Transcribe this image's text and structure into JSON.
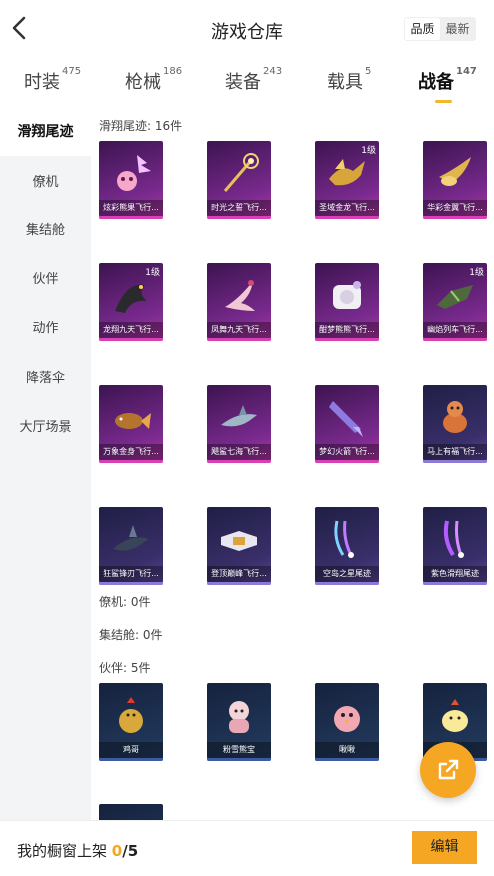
{
  "header": {
    "title": "游戏仓库",
    "sort_quality": "品质",
    "sort_newest": "最新"
  },
  "tabs": [
    {
      "label": "时装",
      "count": "475"
    },
    {
      "label": "枪械",
      "count": "186"
    },
    {
      "label": "装备",
      "count": "243"
    },
    {
      "label": "载具",
      "count": "5"
    },
    {
      "label": "战备",
      "count": "147"
    }
  ],
  "sidebar": {
    "items": [
      {
        "label": "滑翔尾迹"
      },
      {
        "label": "僚机"
      },
      {
        "label": "集结舱"
      },
      {
        "label": "伙伴"
      },
      {
        "label": "动作"
      },
      {
        "label": "降落伞"
      },
      {
        "label": "大厅场景"
      }
    ]
  },
  "sections": {
    "glide": {
      "title": "滑翔尾迹: 16件",
      "items": [
        {
          "name": "炫彩熊果飞行...",
          "level": "",
          "icon": "bear-wing-icon"
        },
        {
          "name": "时光之誓飞行...",
          "level": "",
          "icon": "golden-scepter-icon"
        },
        {
          "name": "圣域金龙飞行...",
          "level": "1级",
          "icon": "golden-dragon-icon"
        },
        {
          "name": "华彩金翼飞行...",
          "level": "",
          "icon": "golden-wing-icon"
        },
        {
          "name": "龙翔九天飞行...",
          "level": "1级",
          "icon": "black-dragon-icon"
        },
        {
          "name": "凤舞九天飞行...",
          "level": "",
          "icon": "phoenix-icon"
        },
        {
          "name": "酣梦熊熊飞行...",
          "level": "",
          "icon": "sleeping-bear-icon"
        },
        {
          "name": "幽焰列车飞行...",
          "level": "1级",
          "icon": "ghost-train-icon"
        },
        {
          "name": "万象金身飞行...",
          "level": "",
          "icon": "golden-fish-icon"
        },
        {
          "name": "飓鲨七海飞行...",
          "level": "",
          "icon": "shark-icon"
        },
        {
          "name": "梦幻火箭飞行...",
          "level": "",
          "icon": "rocket-icon"
        },
        {
          "name": "马上有福飞行...",
          "level": "",
          "icon": "horse-icon"
        },
        {
          "name": "狂鲨锋刃飞行...",
          "level": "",
          "icon": "blade-shark-icon"
        },
        {
          "name": "登顶巅峰飞行...",
          "level": "",
          "icon": "jet-icon"
        },
        {
          "name": "空岛之星尾迹",
          "level": "",
          "icon": "star-trail-icon"
        },
        {
          "name": "紫色滑翔尾迹",
          "level": "",
          "icon": "purple-trail-icon"
        }
      ]
    },
    "wingman": {
      "title": "僚机: 0件"
    },
    "capsule": {
      "title": "集结舱: 0件"
    },
    "partner": {
      "title": "伙伴: 5件",
      "items": [
        {
          "name": "鸡哥",
          "icon": "rooster-icon"
        },
        {
          "name": "粉雪熊宝",
          "icon": "pink-bear-icon"
        },
        {
          "name": "啾啾",
          "icon": "pink-chick-icon"
        },
        {
          "name": "",
          "icon": "yellow-chick-icon"
        },
        {
          "name": "",
          "icon": "partner-icon"
        }
      ]
    }
  },
  "bottom": {
    "shelf_label": "我的橱窗上架 ",
    "shelf_count": "0",
    "shelf_total": "/5",
    "edit_label": "编辑"
  },
  "colors": {
    "accent": "#f5a623",
    "tab_indicator": "#f5b52c",
    "sidebar_bg": "#f3f4f6"
  }
}
